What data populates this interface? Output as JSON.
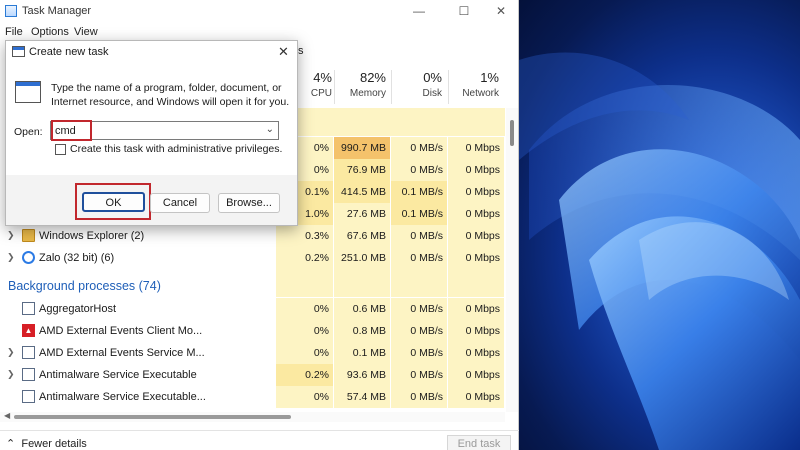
{
  "window": {
    "title": "Task Manager",
    "controls": {
      "minimize": "—",
      "maximize": "☐",
      "close": "✕"
    }
  },
  "menu": {
    "items": [
      "File",
      "Options",
      "View"
    ]
  },
  "tabs_fragment": "s",
  "columns": {
    "cpu": {
      "percent": "4%",
      "label": "CPU"
    },
    "memory": {
      "percent": "82%",
      "label": "Memory"
    },
    "disk": {
      "percent": "0%",
      "label": "Disk"
    },
    "network": {
      "percent": "1%",
      "label": "Network"
    }
  },
  "hidden_rows": [
    {
      "cpu": "0%",
      "memory": "990.7 MB",
      "disk": "0 MB/s",
      "network": "0 Mbps"
    },
    {
      "cpu": "0%",
      "memory": "76.9 MB",
      "disk": "0 MB/s",
      "network": "0 Mbps"
    },
    {
      "cpu": "0.1%",
      "memory": "414.5 MB",
      "disk": "0.1 MB/s",
      "network": "0 Mbps"
    },
    {
      "cpu": "1.0%",
      "memory": "27.6 MB",
      "disk": "0.1 MB/s",
      "network": "0 Mbps"
    }
  ],
  "apps": [
    {
      "name": "Windows Explorer (2)",
      "cpu": "0.3%",
      "memory": "67.6 MB",
      "disk": "0 MB/s",
      "network": "0 Mbps",
      "icon": "folder-icon"
    },
    {
      "name": "Zalo (32 bit) (6)",
      "cpu": "0.2%",
      "memory": "251.0 MB",
      "disk": "0 MB/s",
      "network": "0 Mbps",
      "icon": "globe-icon"
    }
  ],
  "background_section": "Background processes (74)",
  "background": [
    {
      "name": "AggregatorHost",
      "cpu": "0%",
      "memory": "0.6 MB",
      "disk": "0 MB/s",
      "network": "0 Mbps",
      "icon": "process-icon",
      "expandable": false
    },
    {
      "name": "AMD External Events Client Mo...",
      "cpu": "0%",
      "memory": "0.8 MB",
      "disk": "0 MB/s",
      "network": "0 Mbps",
      "icon": "amd-icon",
      "expandable": false
    },
    {
      "name": "AMD External Events Service M...",
      "cpu": "0%",
      "memory": "0.1 MB",
      "disk": "0 MB/s",
      "network": "0 Mbps",
      "icon": "process-icon",
      "expandable": true
    },
    {
      "name": "Antimalware Service Executable",
      "cpu": "0.2%",
      "memory": "93.6 MB",
      "disk": "0 MB/s",
      "network": "0 Mbps",
      "icon": "process-icon",
      "expandable": true
    },
    {
      "name": "Antimalware Service Executable...",
      "cpu": "0%",
      "memory": "57.4 MB",
      "disk": "0 MB/s",
      "network": "0 Mbps",
      "icon": "process-icon",
      "expandable": false
    }
  ],
  "footer": {
    "fewer_details": "Fewer details",
    "end_task": "End task"
  },
  "dialog": {
    "title": "Create new task",
    "close": "✕",
    "description": "Type the name of a program, folder, document, or Internet resource, and Windows will open it for you.",
    "open_label": "Open:",
    "open_value": "cmd",
    "admin_checkbox_label": "Create this task with administrative privileges.",
    "ok": "OK",
    "cancel": "Cancel",
    "browse": "Browse..."
  },
  "colors": {
    "highlight": "#c1272d",
    "section": "#1f5fb8",
    "heat_light": "#fdf4c4",
    "heat_dark": "#f4c26b"
  }
}
